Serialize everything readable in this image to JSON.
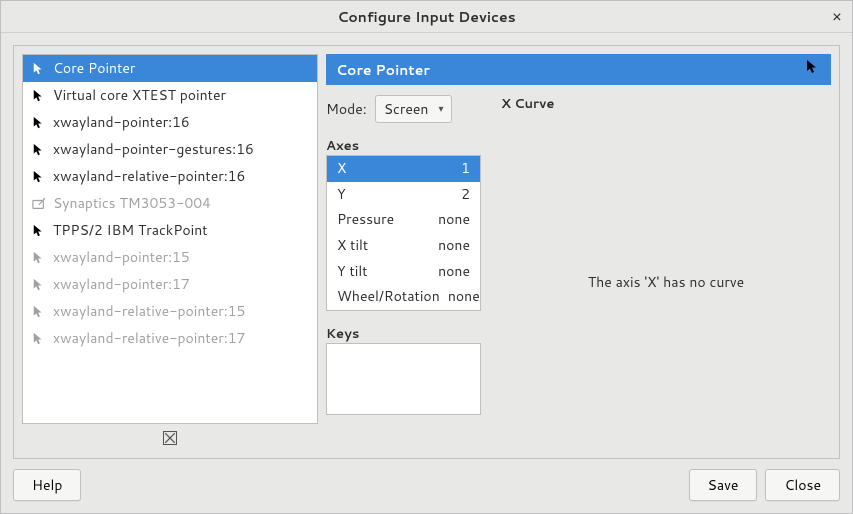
{
  "window": {
    "title": "Configure Input Devices",
    "close_glyph": "×"
  },
  "devices": [
    {
      "name": "Core Pointer",
      "icon": "cursor",
      "state": "selected"
    },
    {
      "name": "Virtual core XTEST pointer",
      "icon": "cursor",
      "state": "normal"
    },
    {
      "name": "xwayland-pointer:16",
      "icon": "cursor",
      "state": "normal"
    },
    {
      "name": "xwayland-pointer-gestures:16",
      "icon": "cursor",
      "state": "normal"
    },
    {
      "name": "xwayland-relative-pointer:16",
      "icon": "cursor",
      "state": "normal"
    },
    {
      "name": "Synaptics TM3053-004",
      "icon": "tablet",
      "state": "disabled"
    },
    {
      "name": "TPPS/2 IBM TrackPoint",
      "icon": "cursor",
      "state": "normal"
    },
    {
      "name": "xwayland-pointer:15",
      "icon": "cursor",
      "state": "disabled"
    },
    {
      "name": "xwayland-pointer:17",
      "icon": "cursor",
      "state": "disabled"
    },
    {
      "name": "xwayland-relative-pointer:15",
      "icon": "cursor",
      "state": "disabled"
    },
    {
      "name": "xwayland-relative-pointer:17",
      "icon": "cursor",
      "state": "disabled"
    }
  ],
  "detail": {
    "header_title": "Core Pointer",
    "mode_label": "Mode:",
    "mode_value": "Screen",
    "axes_label": "Axes",
    "axes": [
      {
        "name": "X",
        "value": "1",
        "selected": true
      },
      {
        "name": "Y",
        "value": "2",
        "selected": false
      },
      {
        "name": "Pressure",
        "value": "none",
        "selected": false
      },
      {
        "name": "X tilt",
        "value": "none",
        "selected": false
      },
      {
        "name": "Y tilt",
        "value": "none",
        "selected": false
      },
      {
        "name": "Wheel/Rotation",
        "value": "none",
        "selected": false
      }
    ],
    "keys_label": "Keys",
    "curve_label": "X Curve",
    "curve_message": "The axis 'X' has no curve"
  },
  "buttons": {
    "help": "Help",
    "save": "Save",
    "close": "Close"
  }
}
